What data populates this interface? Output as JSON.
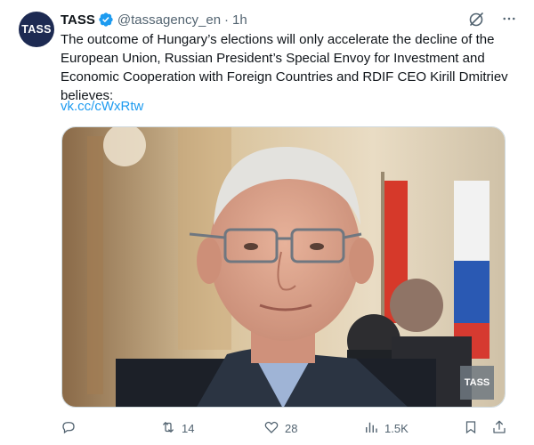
{
  "author": {
    "avatar_text": "TASS",
    "name": "TASS",
    "handle": "@tassagency_en",
    "separator": "·",
    "time": "1h",
    "verified": true
  },
  "tweet": {
    "text": "The outcome of Hungary’s elections will only accelerate the decline of the European Union, Russian President’s Special Envoy for Investment and Economic Cooperation with Foreign Countries and RDIF CEO Kirill Dmitriev believes:",
    "link": "vk.cc/cWxRtw"
  },
  "media": {
    "watermark": "TASS"
  },
  "actions": {
    "reply_count": "",
    "retweet_count": "14",
    "like_count": "28",
    "views_count": "1.5K"
  },
  "colors": {
    "accent": "#1d9bf0",
    "muted": "#536471",
    "avatar_bg": "#1d2a52"
  },
  "icons": [
    "verified-badge-icon",
    "grok-icon",
    "more-icon",
    "reply-icon",
    "retweet-icon",
    "like-icon",
    "views-icon",
    "bookmark-icon",
    "share-icon"
  ]
}
